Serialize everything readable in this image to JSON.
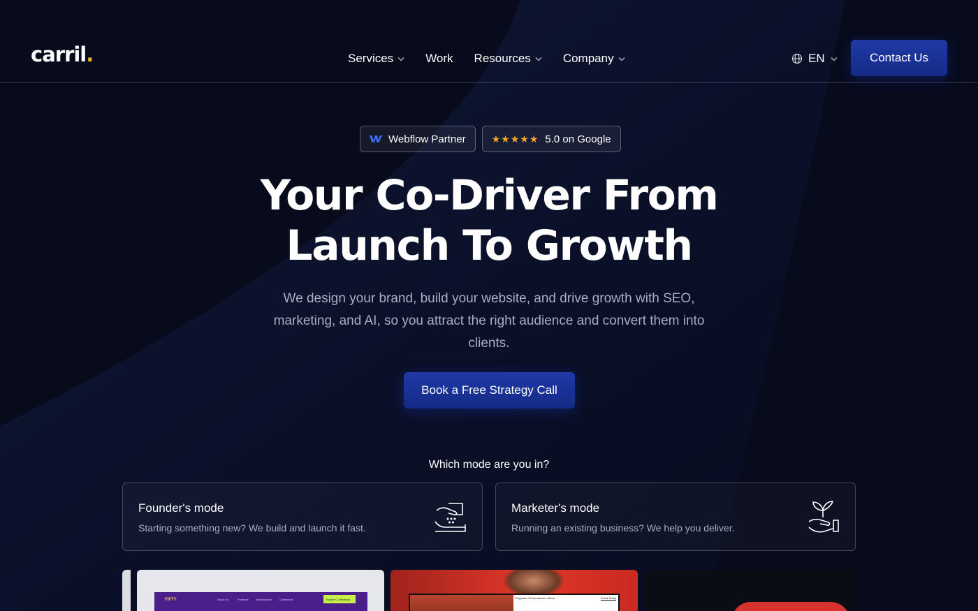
{
  "header": {
    "logo_text": "carril",
    "logo_dot": ".",
    "nav": [
      {
        "label": "Services",
        "has_dropdown": true
      },
      {
        "label": "Work",
        "has_dropdown": false
      },
      {
        "label": "Resources",
        "has_dropdown": true
      },
      {
        "label": "Company",
        "has_dropdown": true
      }
    ],
    "language": "EN",
    "contact_label": "Contact Us"
  },
  "badges": {
    "webflow": "Webflow Partner",
    "stars": "★★★★★",
    "google": "5.0 on Google"
  },
  "hero": {
    "title_line1": "Your Co-Driver From",
    "title_line2": "Launch To Growth",
    "subtitle": "We design your brand, build your website, and drive growth with SEO, marketing, and AI, so you attract the right audience and convert them into clients.",
    "cta_label": "Book a Free Strategy Call"
  },
  "modes": {
    "question": "Which mode are you in?",
    "items": [
      {
        "title": "Founder's mode",
        "description": "Starting something new? We build and launch it fast.",
        "icon": "hand-with-box-icon"
      },
      {
        "title": "Marketer's mode",
        "description": "Running an existing business? We help you deliver.",
        "icon": "hand-with-plant-icon"
      }
    ]
  },
  "previews": {
    "site1_nav": [
      "About Us",
      "Features",
      "Marketplace",
      "Collections"
    ],
    "site1_brand": "FIFTY",
    "site1_button": "Explore Collections",
    "site2_nav": "Programs, Performances, About",
    "site2_link": "Enroll Today"
  },
  "colors": {
    "background": "#070b1c",
    "accent": "#1f3aa8",
    "logo_dot": "#f5b21c",
    "stars": "#f5a623"
  }
}
